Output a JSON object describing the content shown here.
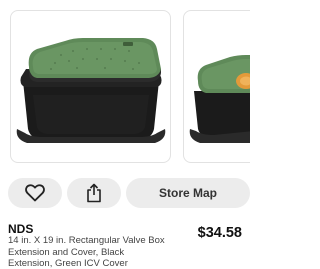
{
  "actions": {
    "favorite_icon": "heart-icon",
    "share_icon": "share-icon",
    "store_map_label": "Store Map"
  },
  "product": {
    "brand": "NDS",
    "description": "14 in. X 19 in. Rectangular Valve Box Extension and Cover, Black Extension, Green ICV Cover",
    "price": "$34.58"
  },
  "colors": {
    "lid_green": "#5f8a59",
    "box_black": "#1b1b1b",
    "button_bg": "#ececec"
  }
}
